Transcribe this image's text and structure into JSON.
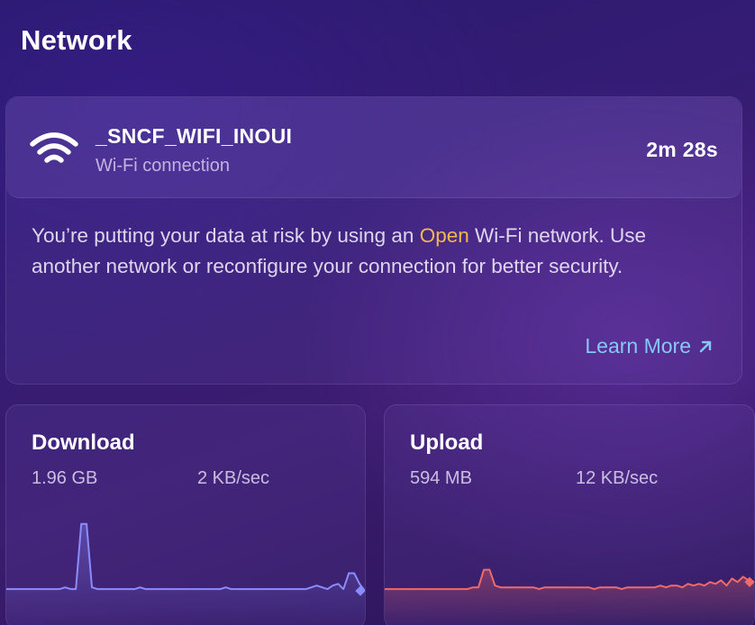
{
  "page": {
    "title": "Network"
  },
  "network": {
    "ssid": "_SNCF_WIFI_INOUI",
    "connection_type": "Wi-Fi connection",
    "duration": "2m 28s",
    "warning_prefix": "You’re putting your data at risk by using an ",
    "warning_highlight": "Open",
    "warning_suffix": " Wi-Fi network. Use another network or reconfigure your connection for better security.",
    "learn_more_label": "Learn More",
    "highlight_color": "#f2b84b",
    "link_color": "#86c8f5",
    "wifi_icon": "wifi-icon",
    "link_icon": "arrow-up-right-icon"
  },
  "download": {
    "title": "Download",
    "total": "1.96 GB",
    "rate": "2 KB/sec",
    "line_color": "#8a8cff",
    "history": [
      3,
      3,
      3,
      3,
      3,
      3,
      3,
      3,
      3,
      3,
      3,
      4,
      3,
      3,
      40,
      40,
      4,
      3,
      3,
      3,
      3,
      3,
      3,
      3,
      3,
      4,
      3,
      3,
      3,
      3,
      3,
      3,
      3,
      3,
      3,
      3,
      3,
      3,
      3,
      3,
      3,
      4,
      3,
      3,
      3,
      3,
      3,
      3,
      3,
      3,
      3,
      3,
      3,
      3,
      3,
      3,
      3,
      4,
      5,
      4,
      3,
      5,
      6,
      3,
      12,
      12,
      6,
      2
    ]
  },
  "upload": {
    "title": "Upload",
    "total": "594 MB",
    "rate": "12 KB/sec",
    "line_color": "#f06a6a",
    "history": [
      3,
      3,
      3,
      3,
      3,
      3,
      3,
      3,
      3,
      3,
      3,
      3,
      3,
      3,
      3,
      3,
      4,
      4,
      14,
      14,
      5,
      4,
      4,
      4,
      4,
      4,
      4,
      4,
      3,
      4,
      4,
      4,
      4,
      4,
      4,
      4,
      4,
      4,
      3,
      4,
      4,
      4,
      4,
      3,
      4,
      4,
      4,
      4,
      4,
      4,
      5,
      4,
      5,
      5,
      4,
      6,
      5,
      6,
      5,
      7,
      6,
      8,
      5,
      9,
      7,
      10,
      8,
      7
    ]
  }
}
